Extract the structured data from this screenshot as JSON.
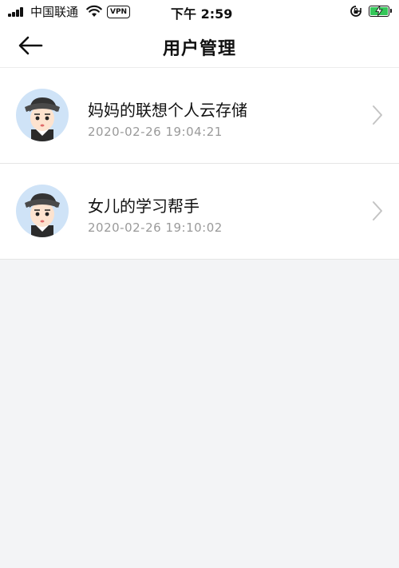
{
  "status_bar": {
    "carrier": "中国联通",
    "vpn": "VPN",
    "time": "下午 2:59"
  },
  "nav": {
    "title": "用户管理",
    "back_icon": "arrow-left-icon"
  },
  "users": [
    {
      "name": "妈妈的联想个人云存储",
      "timestamp": "2020-02-26 19:04:21"
    },
    {
      "name": "女儿的学习帮手",
      "timestamp": "2020-02-26 19:10:02"
    }
  ],
  "colors": {
    "background": "#f3f4f6",
    "battery": "#34c759",
    "avatar_ring": "#cfe3f7",
    "secondary_text": "#9a9a9a"
  }
}
